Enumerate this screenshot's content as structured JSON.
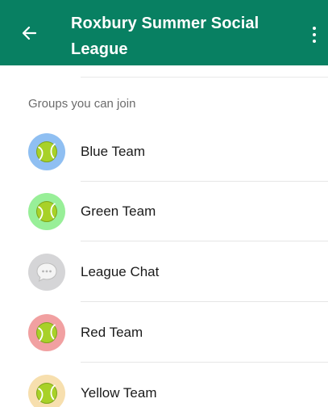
{
  "header": {
    "title": "Roxbury Summer Social League",
    "background_color": "#088062",
    "back_icon": "arrow-left-icon",
    "menu_icon": "more-vertical-icon"
  },
  "section": {
    "label": "Groups you can join"
  },
  "groups": [
    {
      "name": "Blue Team",
      "icon": "tennis-ball-icon",
      "avatar_color": "#8fbff2"
    },
    {
      "name": "Green Team",
      "icon": "tennis-ball-icon",
      "avatar_color": "#98ef98"
    },
    {
      "name": "League Chat",
      "icon": "chat-bubble-icon",
      "avatar_color": "#d5d5d7"
    },
    {
      "name": "Red Team",
      "icon": "tennis-ball-icon",
      "avatar_color": "#f1a0a1"
    },
    {
      "name": "Yellow Team",
      "icon": "tennis-ball-icon",
      "avatar_color": "#f7dfae"
    }
  ]
}
